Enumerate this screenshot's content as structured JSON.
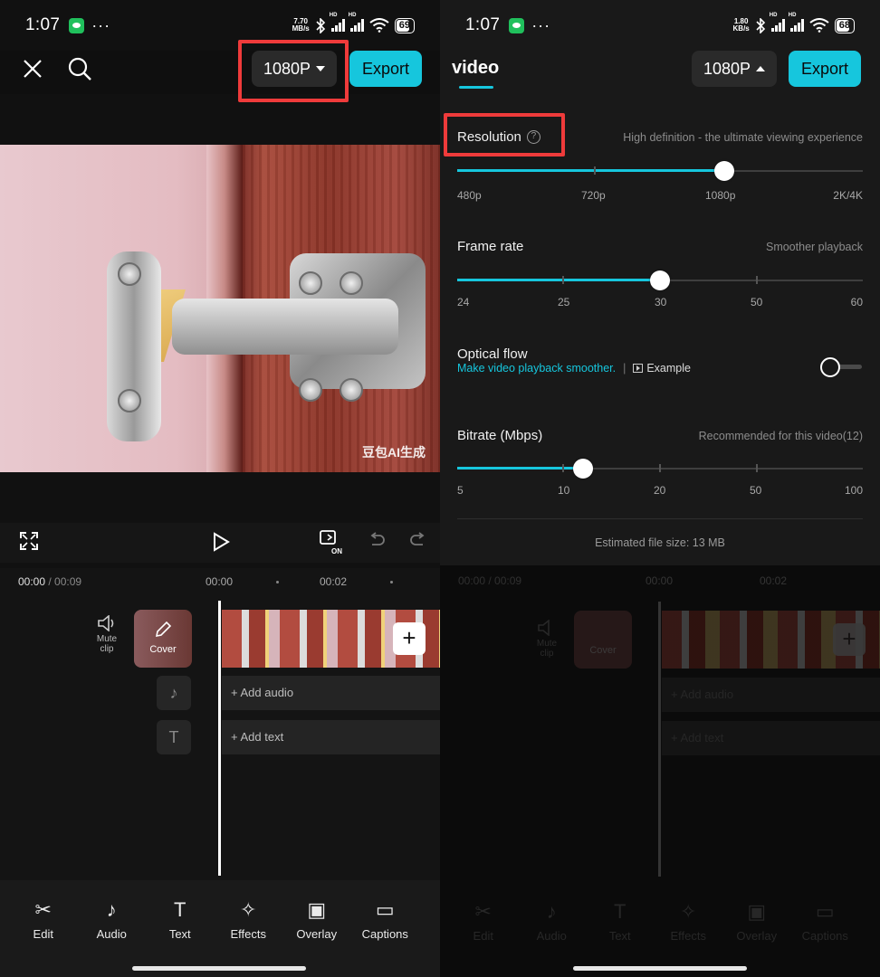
{
  "left": {
    "status": {
      "time": "1:07",
      "net_speed": "7.70",
      "net_unit": "MB/s",
      "battery": "69"
    },
    "top": {
      "resolution_label": "1080P",
      "export_label": "Export"
    },
    "preview": {
      "watermark": "豆包AI生成"
    },
    "timeline": {
      "current": "00:00",
      "total": "/ 00:09",
      "marks": [
        "00:00",
        "00:02"
      ],
      "mute_label": "Mute clip",
      "cover_label": "Cover",
      "add_audio": "Add audio",
      "add_text": "Add text"
    },
    "toolbar": [
      "Edit",
      "Audio",
      "Text",
      "Effects",
      "Overlay",
      "Captions"
    ]
  },
  "right": {
    "status": {
      "time": "1:07",
      "net_speed": "1.80",
      "net_unit": "KB/s",
      "battery": "68"
    },
    "tab_title": "video",
    "top": {
      "resolution_label": "1080P",
      "export_label": "Export"
    },
    "resolution": {
      "label": "Resolution",
      "hint": "High definition - the ultimate viewing experience",
      "ticks": [
        "480p",
        "720p",
        "1080p",
        "2K/4K"
      ],
      "selected": "1080p"
    },
    "frame_rate": {
      "label": "Frame rate",
      "hint": "Smoother playback",
      "ticks": [
        "24",
        "25",
        "30",
        "50",
        "60"
      ],
      "selected": "30"
    },
    "optical_flow": {
      "label": "Optical flow",
      "sub": "Make video playback smoother.",
      "example": "Example",
      "enabled": false
    },
    "bitrate": {
      "label": "Bitrate (Mbps)",
      "hint": "Recommended for this video(12)",
      "ticks": [
        "5",
        "10",
        "20",
        "50",
        "100"
      ],
      "value": 12
    },
    "file_size": "Estimated file size: 13 MB",
    "background_timeline": {
      "current": "00:00",
      "total": "/ 00:09",
      "marks": [
        "00:00",
        "00:02"
      ],
      "mute_label": "Mute clip",
      "cover_label": "Cover",
      "add_audio": "Add audio",
      "add_text": "Add text"
    },
    "background_toolbar": [
      "Edit",
      "Audio",
      "Text",
      "Effects",
      "Overlay",
      "Captions"
    ]
  },
  "colors": {
    "accent": "#16c6dd",
    "highlight_box": "#ef3b3b"
  }
}
